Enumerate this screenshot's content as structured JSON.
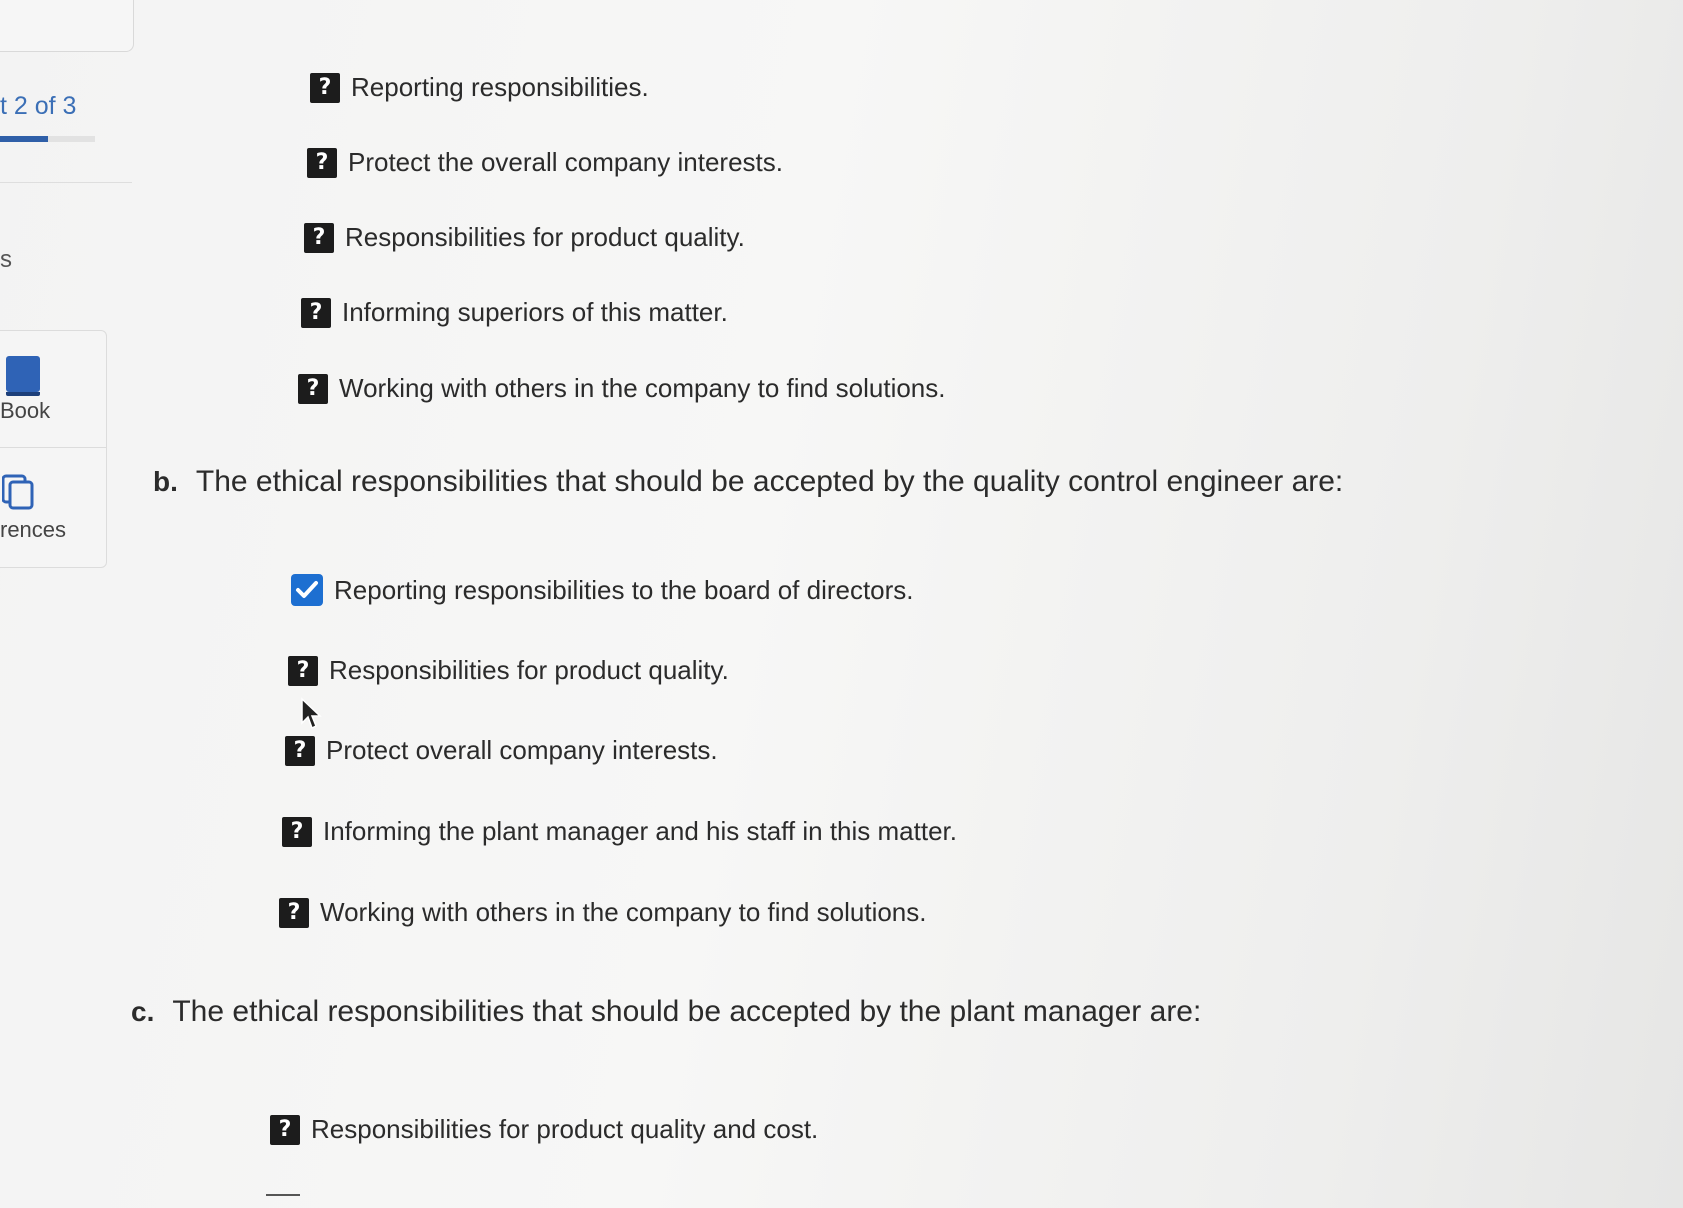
{
  "sidebar": {
    "part_label": "t 2 of 3",
    "progress": 0.5,
    "fragment_s": "s",
    "nav_items": [
      {
        "label": "Book",
        "icon": "ebook-icon"
      },
      {
        "label": "rences",
        "icon": "references-icon"
      }
    ]
  },
  "part_a": {
    "options": [
      {
        "status": "unanswered",
        "icon": "question-mark-icon",
        "text": "Reporting responsibilities."
      },
      {
        "status": "unanswered",
        "icon": "question-mark-icon",
        "text": "Protect the overall company interests."
      },
      {
        "status": "unanswered",
        "icon": "question-mark-icon",
        "text": "Responsibilities for product quality."
      },
      {
        "status": "unanswered",
        "icon": "question-mark-icon",
        "text": "Informing superiors of this matter."
      },
      {
        "status": "unanswered",
        "icon": "question-mark-icon",
        "text": "Working with others in the company to find solutions."
      }
    ]
  },
  "part_b": {
    "letter": "b.",
    "prompt": "The ethical responsibilities that should be accepted by the quality control engineer are:",
    "options": [
      {
        "status": "checked",
        "icon": "checkmark-icon",
        "text": "Reporting responsibilities to the board of directors."
      },
      {
        "status": "unanswered",
        "icon": "question-mark-icon",
        "text": "Responsibilities for product quality."
      },
      {
        "status": "unanswered",
        "icon": "question-mark-icon",
        "text": "Protect overall company interests."
      },
      {
        "status": "unanswered",
        "icon": "question-mark-icon",
        "text": "Informing the plant manager and his staff in this matter."
      },
      {
        "status": "unanswered",
        "icon": "question-mark-icon",
        "text": "Working with others in the company to find solutions."
      }
    ]
  },
  "part_c": {
    "letter": "c.",
    "prompt": "The ethical responsibilities that should be accepted by the plant manager are:",
    "options": [
      {
        "status": "unanswered",
        "icon": "question-mark-icon",
        "text": "Responsibilities for product quality and cost."
      }
    ]
  },
  "glyphs": {
    "question": "?"
  },
  "colors": {
    "accent": "#2f5fa8",
    "check": "#1d6fd1",
    "icon_dark": "#1c1c1c"
  }
}
